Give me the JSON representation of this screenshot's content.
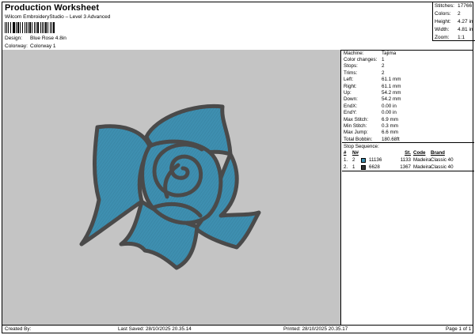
{
  "header": {
    "title": "Production Worksheet",
    "subtitle": "Wilcom EmbroideryStudio – Level 3 Advanced",
    "design_label": "Design:",
    "design_value": "Blue Rose 4.8in",
    "colorway_label": "Colorway:",
    "colorway_value": "Colorway 1"
  },
  "stats": [
    {
      "label": "Stitches:",
      "value": "17766"
    },
    {
      "label": "Colors:",
      "value": "2"
    },
    {
      "label": "Height:",
      "value": "4.27 in"
    },
    {
      "label": "Width:",
      "value": "4.81 in"
    },
    {
      "label": "Zoom:",
      "value": "1:1"
    }
  ],
  "info": [
    {
      "label": "Machine:",
      "value": "Tajima"
    },
    {
      "label": "Color changes:",
      "value": "1"
    },
    {
      "label": "Stops:",
      "value": "2"
    },
    {
      "label": "Trims:",
      "value": "2"
    },
    {
      "label": "Left:",
      "value": "61.1 mm"
    },
    {
      "label": "Right:",
      "value": "61.1 mm"
    },
    {
      "label": "Up:",
      "value": "54.2 mm"
    },
    {
      "label": "Down:",
      "value": "54.2 mm"
    },
    {
      "label": "EndX:",
      "value": "0.00 in"
    },
    {
      "label": "EndY:",
      "value": "0.00 in"
    },
    {
      "label": "Max Stitch:",
      "value": "6.9 mm"
    },
    {
      "label": "Min Stitch:",
      "value": "0.3 mm"
    },
    {
      "label": "Max Jump:",
      "value": "6.6 mm"
    },
    {
      "label": "Total Bobbin:",
      "value": "180.68ft"
    }
  ],
  "sequence": {
    "title": "Stop Sequence:",
    "headers": {
      "idx": "#",
      "n": "N#",
      "st": "St.",
      "code": "Code",
      "brand": "Brand"
    },
    "rows": [
      {
        "idx": "1.",
        "n": "2",
        "color": "#3e8fb0",
        "color_name": "11136",
        "st": "1133",
        "code": "Madeira",
        "brand": "Classic 40"
      },
      {
        "idx": "2.",
        "n": "1",
        "color": "#333333",
        "color_name": "6628",
        "st": "1367",
        "code": "Madeira",
        "brand": "Classic 40"
      }
    ]
  },
  "footer": {
    "created_by": "Created By:",
    "last_saved": "Last Saved: 28/10/2025 20.35.14",
    "printed": "Printed: 28/10/2025 20.35.17",
    "page": "Page 1 of 1"
  },
  "colors": {
    "background": "#c4c4c4",
    "petal_fill": "#3e8fb0",
    "outline": "#4a4a4a"
  }
}
